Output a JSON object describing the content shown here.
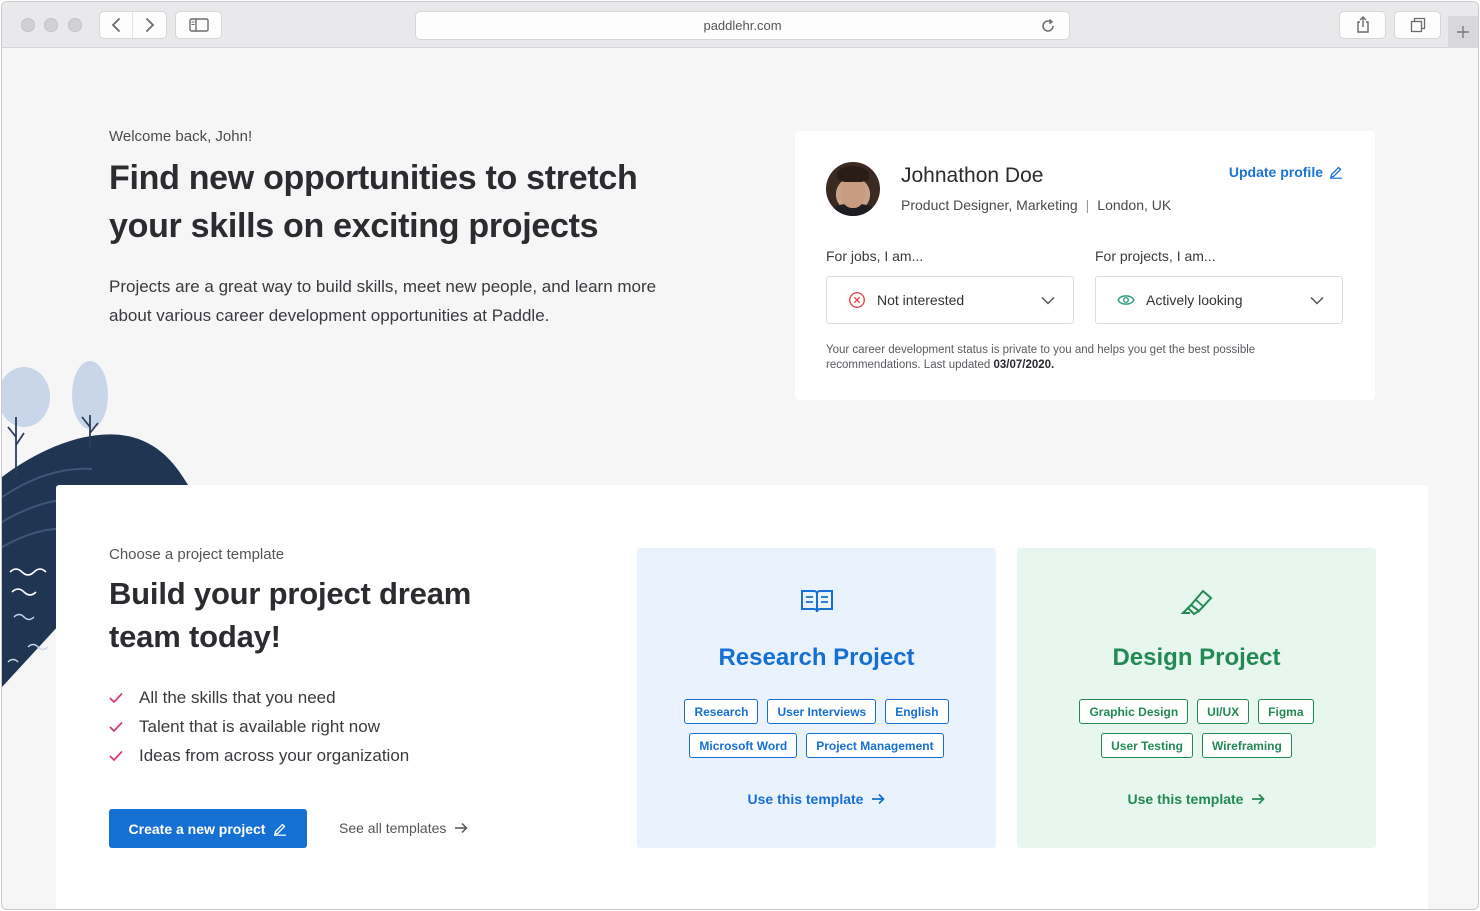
{
  "browser": {
    "url": "paddlehr.com"
  },
  "hero": {
    "welcome": "Welcome back, John!",
    "title": "Find new opportunities to stretch your skills on exciting projects",
    "description": "Projects are a great way to build skills, meet new people, and learn more about various career development opportunities at Paddle."
  },
  "profile": {
    "name": "Johnathon Doe",
    "role": "Product Designer, Marketing",
    "separator": "|",
    "location": "London, UK",
    "update_label": "Update profile",
    "jobs_label": "For jobs, I am...",
    "jobs_value": "Not interested",
    "projects_label": "For projects, I am...",
    "projects_value": "Actively looking",
    "privacy_text": "Your career development status is private to you and helps you get the best possible recommendations. Last updated ",
    "last_updated": "03/07/2020."
  },
  "templates_section": {
    "eyebrow": "Choose a project template",
    "title": "Build your project dream team today!",
    "bullets": [
      "All the skills that you need",
      "Talent that is available right now",
      "Ideas from across your organization"
    ],
    "create_label": "Create a new project",
    "see_all_label": "See all templates"
  },
  "templates": [
    {
      "title": "Research Project",
      "icon": "book-icon",
      "tags": [
        "Research",
        "User Interviews",
        "English",
        "Microsoft Word",
        "Project Management"
      ],
      "cta": "Use this template",
      "accent": "#1670d3"
    },
    {
      "title": "Design Project",
      "icon": "highlighter-icon",
      "tags": [
        "Graphic Design",
        "UI/UX",
        "Figma",
        "User Testing",
        "Wireframing"
      ],
      "cta": "Use this template",
      "accent": "#238a55"
    }
  ],
  "colors": {
    "primary": "#1670d3",
    "success": "#238a55",
    "danger": "#e04b4b",
    "status_ok": "#2e9e7e"
  }
}
